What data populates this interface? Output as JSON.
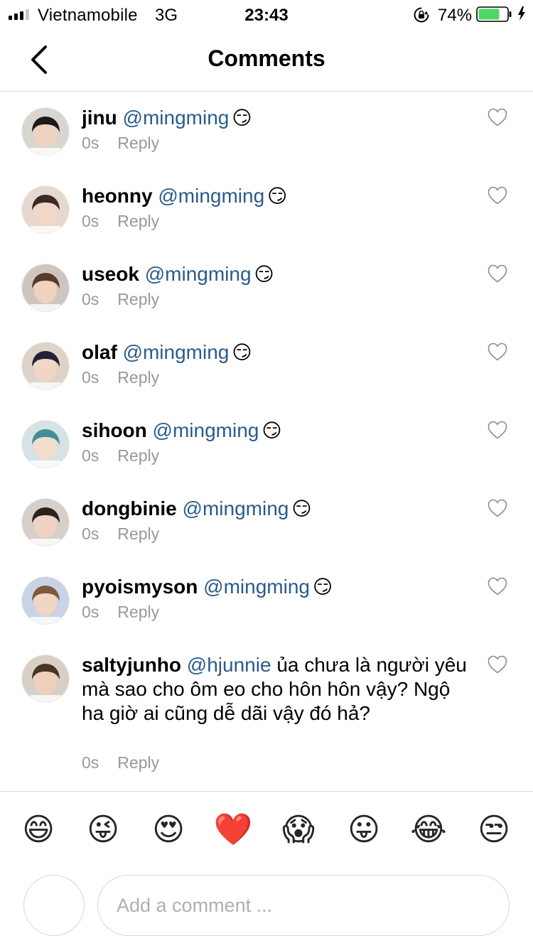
{
  "status_bar": {
    "carrier": "Vietnamobile",
    "network": "3G",
    "time": "23:43",
    "battery_percent": "74%",
    "battery_level": 0.74,
    "signal_bars_active": 3,
    "signal_bars_total": 4
  },
  "header": {
    "title": "Comments",
    "back_icon": "chevron-left-icon"
  },
  "comments": [
    {
      "username": "jinu",
      "mention": "@mingming",
      "text": "",
      "emoji": "😏",
      "time": "0s",
      "reply": "Reply"
    },
    {
      "username": "heonny",
      "mention": "@mingming",
      "text": "",
      "emoji": "😏",
      "time": "0s",
      "reply": "Reply"
    },
    {
      "username": "useok",
      "mention": "@mingming",
      "text": "",
      "emoji": "😏",
      "time": "0s",
      "reply": "Reply"
    },
    {
      "username": "olaf",
      "mention": "@mingming",
      "text": "",
      "emoji": "😏",
      "time": "0s",
      "reply": "Reply"
    },
    {
      "username": "sihoon",
      "mention": "@mingming",
      "text": "",
      "emoji": "😏",
      "time": "0s",
      "reply": "Reply"
    },
    {
      "username": "dongbinie",
      "mention": "@mingming",
      "text": "",
      "emoji": "😏",
      "time": "0s",
      "reply": "Reply"
    },
    {
      "username": "pyoismyson",
      "mention": "@mingming",
      "text": "",
      "emoji": "😏",
      "time": "0s",
      "reply": "Reply"
    },
    {
      "username": "saltyjunho",
      "mention": "@hjunnie",
      "text": "ủa chưa là người yêu mà sao cho ôm eo cho hôn hôn vậy? Ngộ ha giờ ai cũng dễ dãi vậy đó hả?",
      "emoji": "",
      "time": "0s",
      "reply": "Reply"
    }
  ],
  "quick_emojis": [
    "😄",
    "😜",
    "😍",
    "❤️",
    "😱",
    "😛",
    "😂",
    "😒"
  ],
  "composer": {
    "placeholder": "Add a comment ..."
  },
  "colors": {
    "mention": "#2a5b8a",
    "meta": "#999999",
    "battery_fill": "#4cd964",
    "divider": "#dbdbdb"
  }
}
